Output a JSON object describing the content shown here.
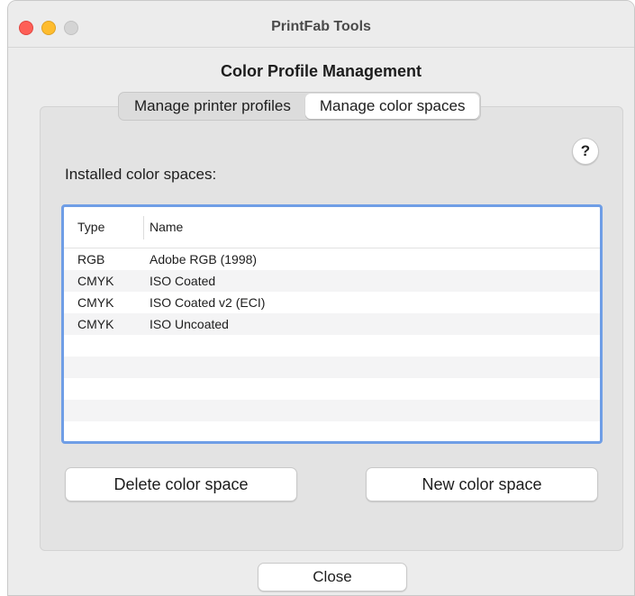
{
  "window": {
    "title": "PrintFab Tools"
  },
  "section_title": "Color Profile Management",
  "tabs": [
    {
      "label": "Manage printer profiles",
      "active": false
    },
    {
      "label": "Manage color spaces",
      "active": true
    }
  ],
  "help_button": {
    "label": "?"
  },
  "installed_label": "Installed color spaces:",
  "table": {
    "columns": [
      "Type",
      "Name"
    ],
    "rows": [
      {
        "type": "RGB",
        "name": "Adobe RGB (1998)"
      },
      {
        "type": "CMYK",
        "name": "ISO Coated"
      },
      {
        "type": "CMYK",
        "name": "ISO Coated v2 (ECI)"
      },
      {
        "type": "CMYK",
        "name": "ISO Uncoated"
      }
    ]
  },
  "buttons": {
    "delete": "Delete color space",
    "new": "New color space",
    "close": "Close"
  },
  "colors": {
    "focus_ring": "#6f9ee6",
    "traffic_close": "#fe5f57",
    "traffic_min": "#febc2e",
    "traffic_max": "#d4d4d4"
  }
}
